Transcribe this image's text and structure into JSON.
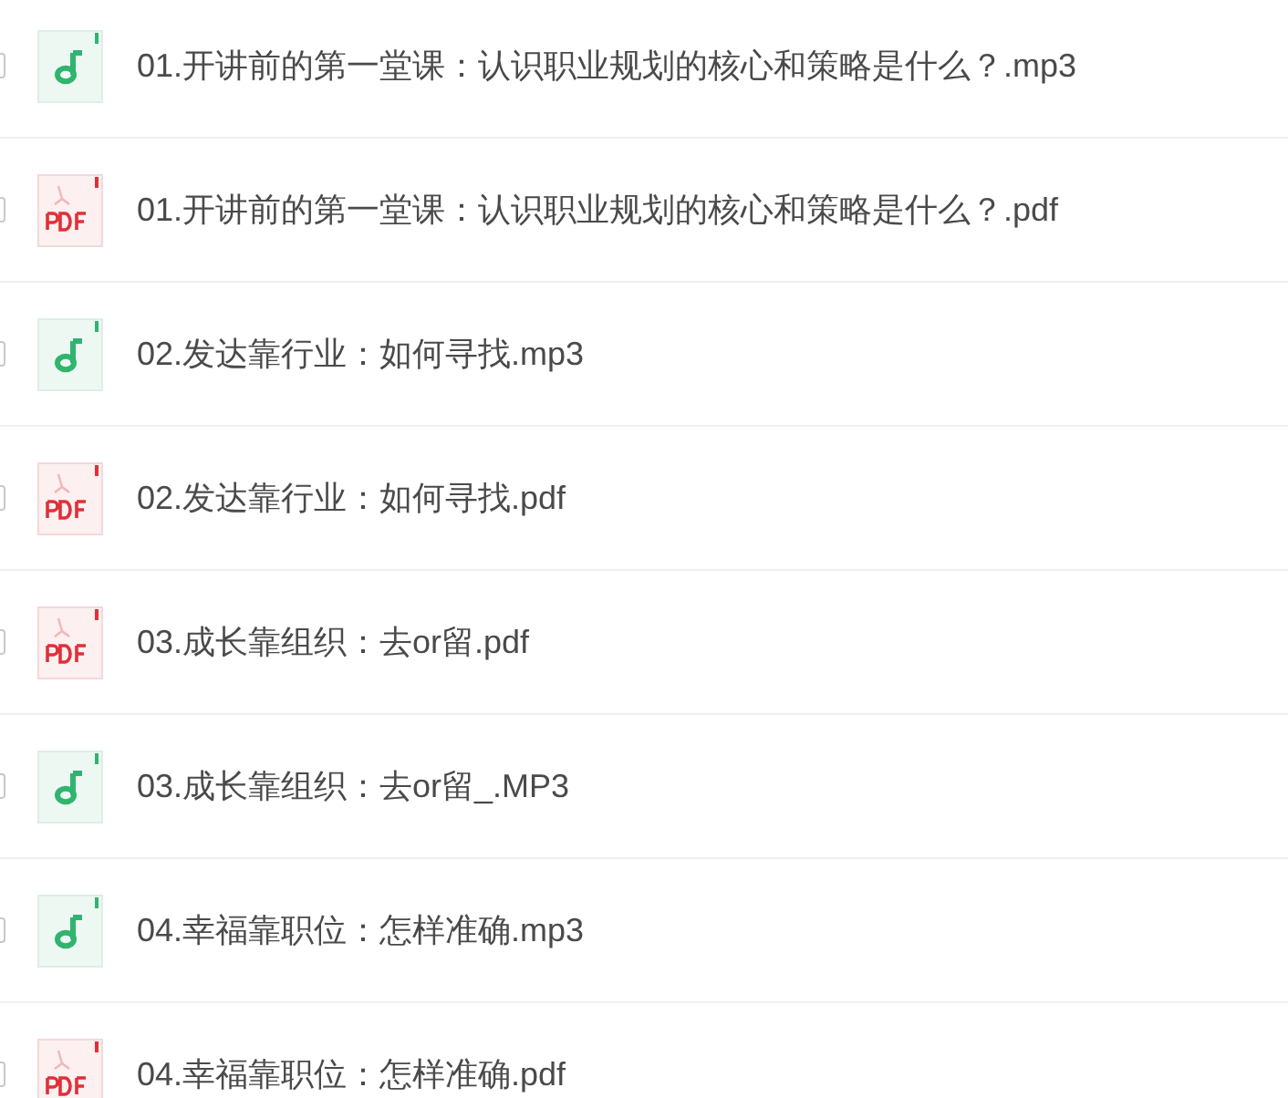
{
  "files": [
    {
      "kind": "audio",
      "name": "01.开讲前的第一堂课：认识职业规划的核心和策略是什么？.mp3",
      "checked": false
    },
    {
      "kind": "pdf",
      "name": "01.开讲前的第一堂课：认识职业规划的核心和策略是什么？.pdf",
      "checked": false
    },
    {
      "kind": "audio",
      "name": "02.发达靠行业：如何寻找.mp3",
      "checked": false
    },
    {
      "kind": "pdf",
      "name": "02.发达靠行业：如何寻找.pdf",
      "checked": false
    },
    {
      "kind": "pdf",
      "name": "03.成长靠组织：去or留.pdf",
      "checked": false
    },
    {
      "kind": "audio",
      "name": "03.成长靠组织：去or留_.MP3",
      "checked": false
    },
    {
      "kind": "audio",
      "name": "04.幸福靠职位：怎样准确.mp3",
      "checked": false
    },
    {
      "kind": "pdf",
      "name": "04.幸福靠职位：怎样准确.pdf",
      "checked": false
    }
  ]
}
